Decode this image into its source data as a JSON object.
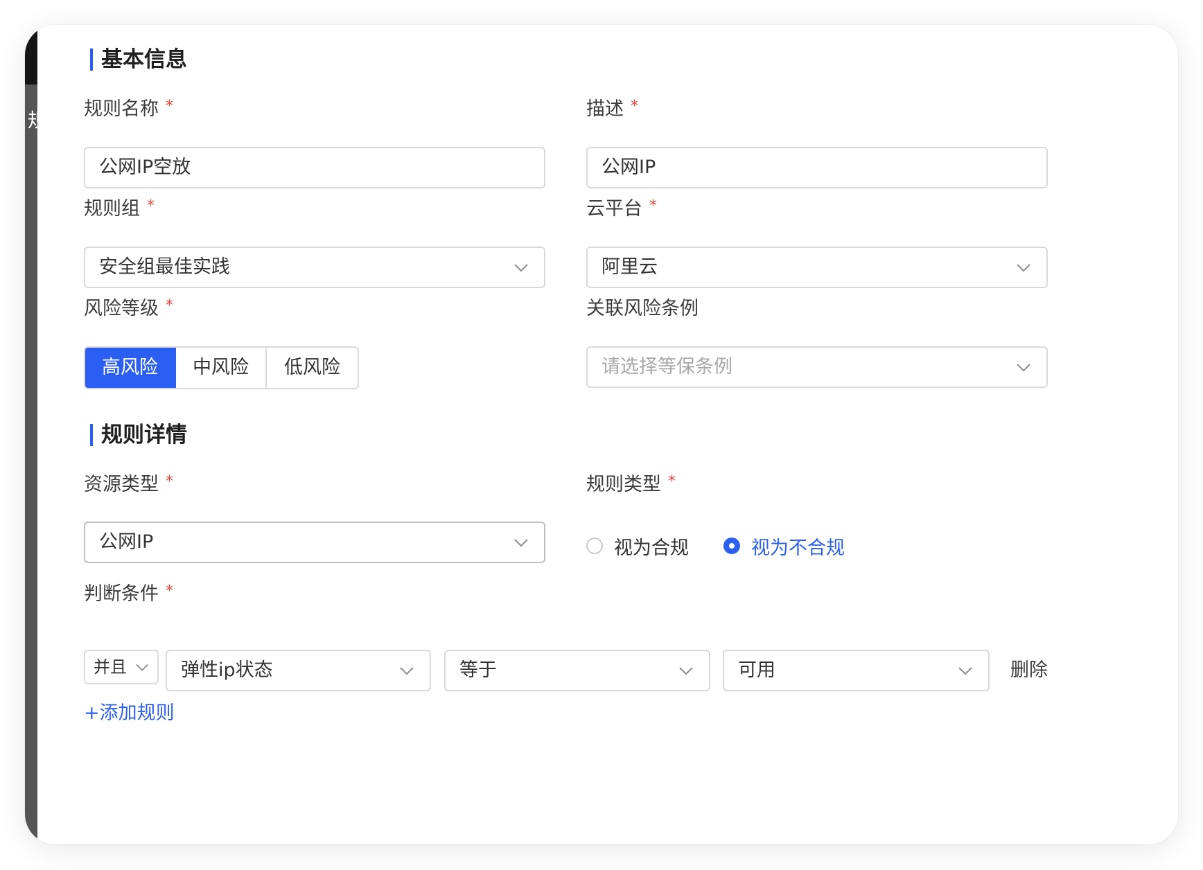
{
  "background_peek_text": "规",
  "sections": {
    "basic": "基本信息",
    "detail": "规则详情"
  },
  "fields": {
    "rule_name": {
      "label": "规则名称",
      "required": "*",
      "value": "公网IP空放"
    },
    "description": {
      "label": "描述",
      "required": "*",
      "value": "公网IP"
    },
    "rule_group": {
      "label": "规则组",
      "required": "*",
      "value": "安全组最佳实践"
    },
    "cloud_platform": {
      "label": "云平台",
      "required": "*",
      "value": "阿里云"
    },
    "risk_level": {
      "label": "风险等级",
      "required": "*",
      "options": [
        "高风险",
        "中风险",
        "低风险"
      ],
      "selected": "高风险"
    },
    "related_risk": {
      "label": "关联风险条例",
      "placeholder": "请选择等保条例"
    },
    "resource_type": {
      "label": "资源类型",
      "required": "*",
      "value": "公网IP"
    },
    "rule_type": {
      "label": "规则类型",
      "required": "*",
      "options": [
        "视为合规",
        "视为不合规"
      ],
      "selected": "视为不合规"
    },
    "condition": {
      "label": "判断条件",
      "required": "*",
      "logic": "并且",
      "attribute": "弹性ip状态",
      "operator": "等于",
      "value": "可用",
      "delete_label": "删除"
    }
  },
  "add_rule_label": "+添加规则",
  "colors": {
    "accent": "#2b5ff4",
    "required": "#e8453c",
    "border": "#d9d9d9"
  }
}
